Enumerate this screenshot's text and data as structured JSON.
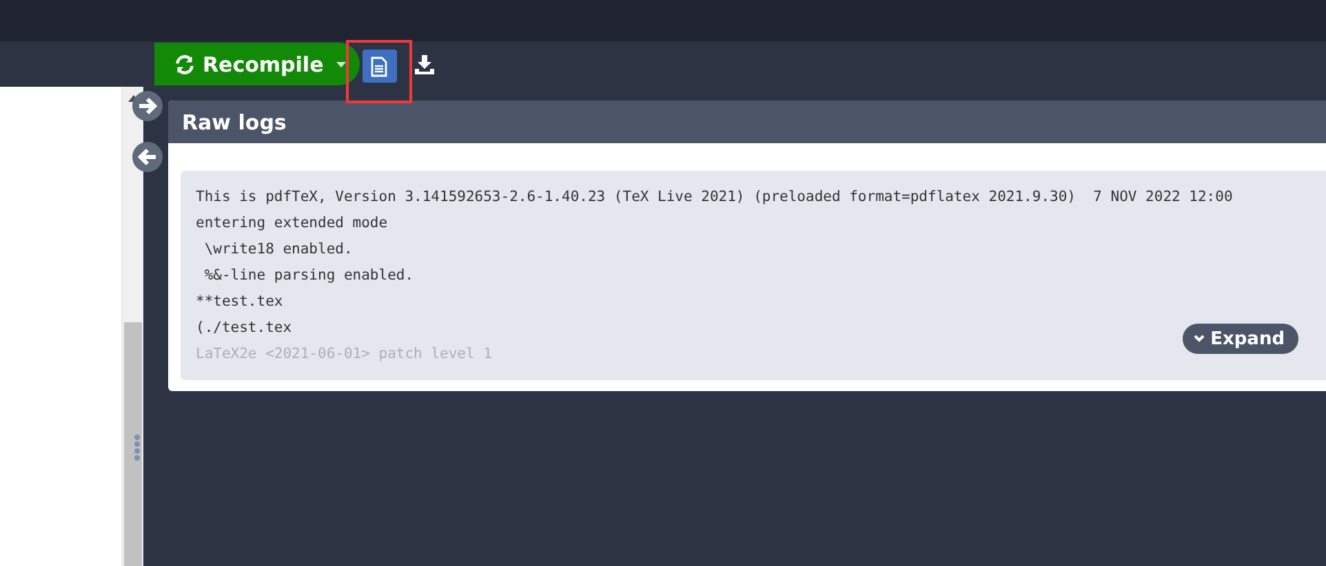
{
  "toolbar": {
    "recompile_button": "Recompile",
    "logs_button_selected": true
  },
  "raw_logs": {
    "title": "Raw logs",
    "lines": [
      {
        "text": "This is pdfTeX, Version 3.141592653-2.6-1.40.23 (TeX Live 2021) (preloaded format=pdflatex 2021.9.30)  7 NOV 2022 12:00",
        "faded": false
      },
      {
        "text": "entering extended mode",
        "faded": false
      },
      {
        "text": " \\write18 enabled.",
        "faded": false
      },
      {
        "text": " %&-line parsing enabled.",
        "faded": false
      },
      {
        "text": "**test.tex",
        "faded": false
      },
      {
        "text": "(./test.tex",
        "faded": false
      },
      {
        "text": "LaTeX2e <2021-06-01> patch level 1",
        "faded": true
      }
    ],
    "expand_button": "Expand"
  }
}
